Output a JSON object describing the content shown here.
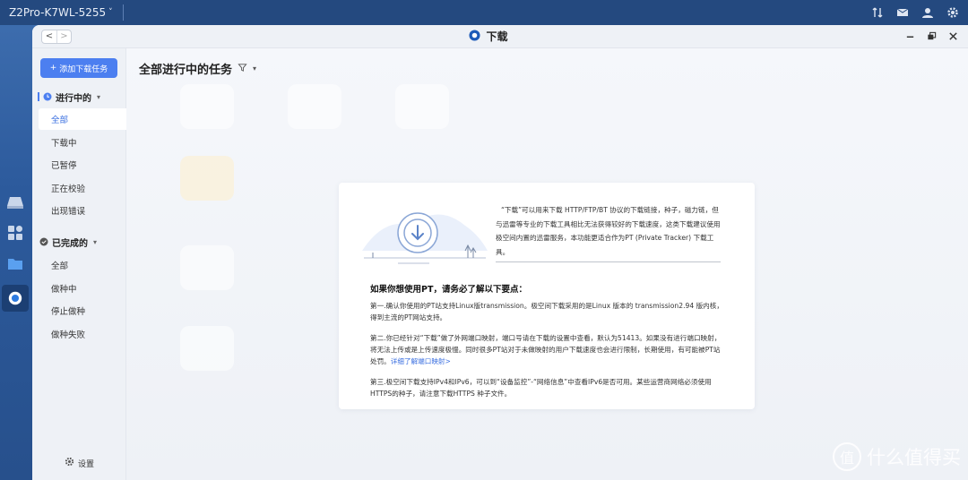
{
  "os": {
    "device_name": "Z2Pro-K7WL-5255",
    "chevron": "˅",
    "icons": [
      "transfer-icon",
      "mail-icon",
      "user-icon",
      "gear-icon"
    ]
  },
  "window": {
    "title": "下载",
    "back": "<",
    "forward": ">",
    "controls": [
      "minimize-icon",
      "restore-icon",
      "close-icon"
    ]
  },
  "sidebar": {
    "add_button": "添加下载任务",
    "add_plus": "+",
    "in_progress": {
      "label": "进行中的",
      "items": [
        "全部",
        "下载中",
        "已暂停",
        "正在校验",
        "出现错误"
      ]
    },
    "completed": {
      "label": "已完成的",
      "items": [
        "全部",
        "做种中",
        "停止做种",
        "做种失败"
      ]
    },
    "settings_label": "设置"
  },
  "main": {
    "title": "全部进行中的任务",
    "filter_icon": "filter-icon"
  },
  "card": {
    "intro": "“下载”可以用来下载 HTTP/FTP/BT 协议的下载链接，种子，磁力链，但与迅雷等专业的下载工具相比无法获得较好的下载速度，这类下载建议使用极空间内置的迅雷服务，本功能更适合作为PT (Private Tracker) 下载工具。",
    "heading": "如果你想使用PT，请务必了解以下要点：",
    "point1": "第一.确认你使用的PT站支持Linux版transmission。极空间下载采用的是Linux 版本的 transmission2.94 版内核，得到主流的PT网站支持。",
    "point2": "第二.你已经针对“下载”做了外网端口映射，端口号请在下载的设置中查看，默认为51413。如果没有进行端口映射，将无法上传或是上传速度极慢。同时很多PT站对于未做映射的用户下载速度也会进行限制，长期使用，有可能被PT站处罚。",
    "point2_link": "详细了解端口映射>",
    "point3": "第三.极空间下载支持IPv4和IPv6，可以到“设备监控”-“网络信息”中查看IPv6是否可用。某些运营商网络必须使用HTTPS的种子，请注意下载HTTPS 种子文件。"
  },
  "watermark": {
    "logo": "值",
    "text": "什么值得买"
  }
}
